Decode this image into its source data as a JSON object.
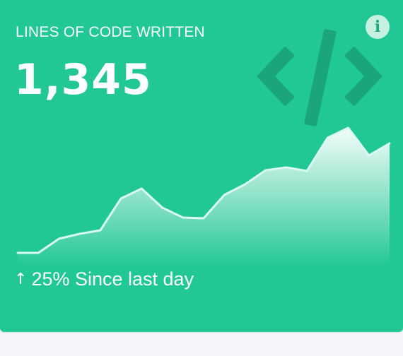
{
  "card": {
    "title": "LINES OF CODE WRITTEN",
    "value": "1,345",
    "change": {
      "arrow_icon": "arrow-up-icon",
      "arrow_glyph": "↑",
      "text": "25% Since last day"
    },
    "info_icon": "info-icon",
    "info_glyph": "i",
    "code_icon": "code-icon",
    "colors": {
      "background": "#21c795",
      "icon_dark": "#1aa57b",
      "line": "#d9fbef"
    }
  },
  "chart_data": {
    "type": "area",
    "values": [
      0,
      0,
      20,
      27,
      32,
      77,
      91,
      64,
      50,
      49,
      82,
      97,
      117,
      121,
      116,
      163,
      177,
      138,
      155
    ]
  }
}
